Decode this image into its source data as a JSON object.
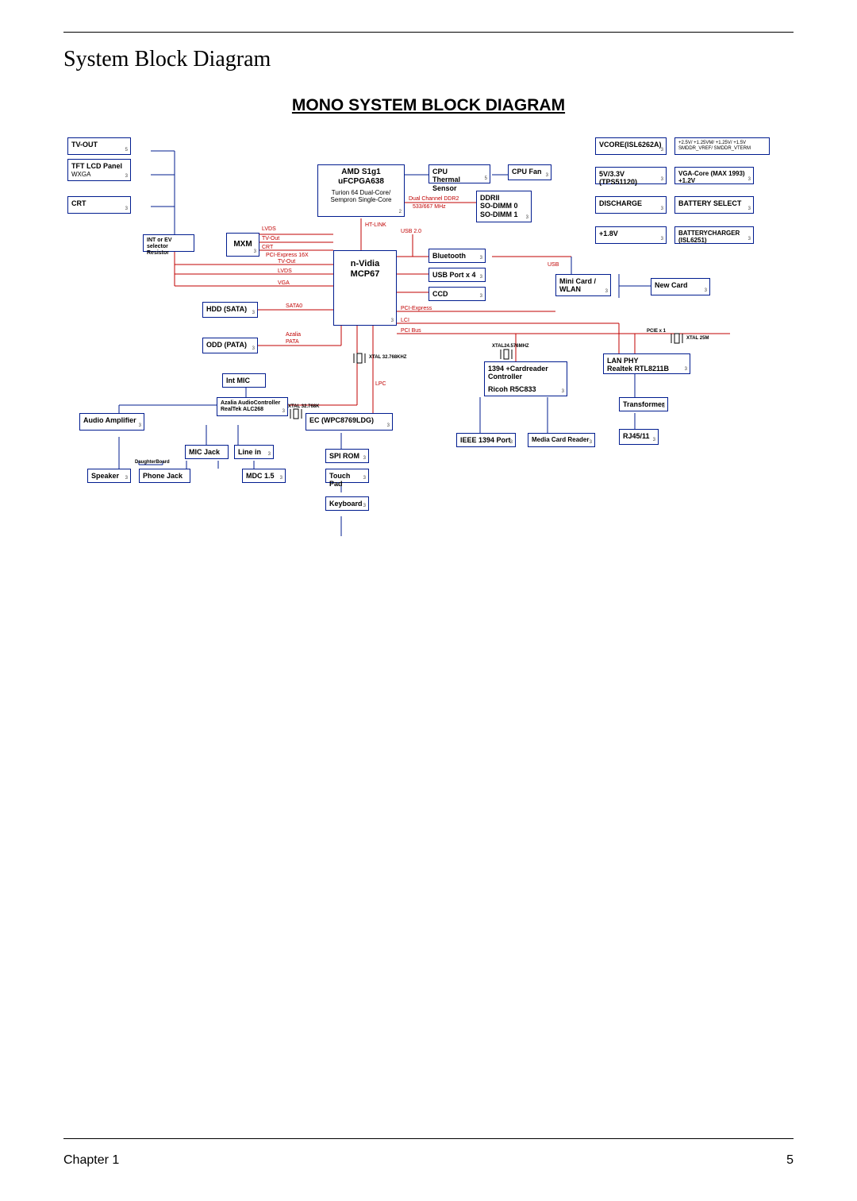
{
  "page": {
    "section_title": "System Block Diagram",
    "diagram_title": "MONO SYSTEM BLOCK DIAGRAM",
    "chapter_label": "Chapter 1",
    "page_number": "5"
  },
  "blocks": {
    "tv_out": "TV-OUT",
    "tft_lcd": "TFT LCD Panel",
    "tft_lcd_sub": "WXGA",
    "crt": "CRT",
    "int_ev": "INT or EV\nselector Resistor",
    "mxm": "MXM",
    "cpu": "AMD S1g1\nuFCPGA638",
    "cpu_sub": "Turion 64 Dual-Core/\nSempron Single-Core",
    "cpu_thermal": "CPU\nThermal Sensor",
    "cpu_fan": "CPU Fan",
    "ddr": "DDRII\nSO-DIMM 0\nSO-DIMM 1",
    "mcp": "n-Vidia\nMCP67",
    "bluetooth": "Bluetooth",
    "usb_port": "USB Port x 4",
    "ccd": "CCD",
    "minicard": "Mini Card /\nWLAN",
    "newcard": "New Card",
    "hdd": "HDD (SATA)",
    "odd": "ODD (PATA)",
    "int_mic": "Int MIC",
    "azalia": "Azalia AudioController\nRealTek ALC268",
    "audio_amp": "Audio Amplifier",
    "mic_jack": "MIC Jack",
    "line_in": "Line in",
    "phone_jack": "Phone Jack",
    "speaker": "Speaker",
    "mdc": "MDC 1.5",
    "ec": "EC (WPC8769LDG)",
    "spirom": "SPI ROM",
    "touchpad": "Touch Pad",
    "keyboard": "Keyboard",
    "ricoh": "1394 +Cardreader\nController",
    "ricoh2": "Ricoh R5C833",
    "ieee1394": "IEEE 1394 Port",
    "media_card": "Media Card Reader",
    "lan_phy": "LAN PHY\nRealtek RTL8211B",
    "transformer": "Transformer",
    "rj45": "RJ45/11",
    "vcore": "VCORE(ISL6262A)",
    "rails": "+2.5V/ +1.25VM/ +1.25V/ +1.5V\nSMDDR_VREF/ SMDDR_VTERM",
    "v5v": "5V/3.3V (TPS51120)",
    "vga_core": "VGA-Core (MAX 1993)\n+1.2V",
    "discharge": "DISCHARGE",
    "batt_sel": "BATTERY SELECT",
    "v1_8": "+1.8V",
    "batt_chg": "BATTERYCHARGER\n(ISL6251)"
  },
  "labels": {
    "pci_express_16": "PCI-Express 16X",
    "lvds": "LVDS",
    "tv_out_l": "TV-Out",
    "crt_l": "CRT",
    "vga_l": "VGA",
    "sata0": "SATA0",
    "pata": "PATA",
    "azalia_l": "Azalia",
    "lpc": "LPC",
    "ht_link": "HT-LINK",
    "dual_ddr": "Dual Channel DDR2",
    "ddr_freq": "533/667 MHz",
    "usb20": "USB 2.0",
    "usb": "USB",
    "pci_express": "PCI-Express",
    "lci": "LCI",
    "pci_bus": "PCI Bus",
    "xtal1": "XTAL\n32.768KHZ",
    "xtal2": "XTAL\n32.768K",
    "xtal3": "XTAL24.576MHZ",
    "xtal4": "XTAL\n25M",
    "pcie_lane": "PCIE x 1",
    "daughter": "DaughterBoard"
  }
}
